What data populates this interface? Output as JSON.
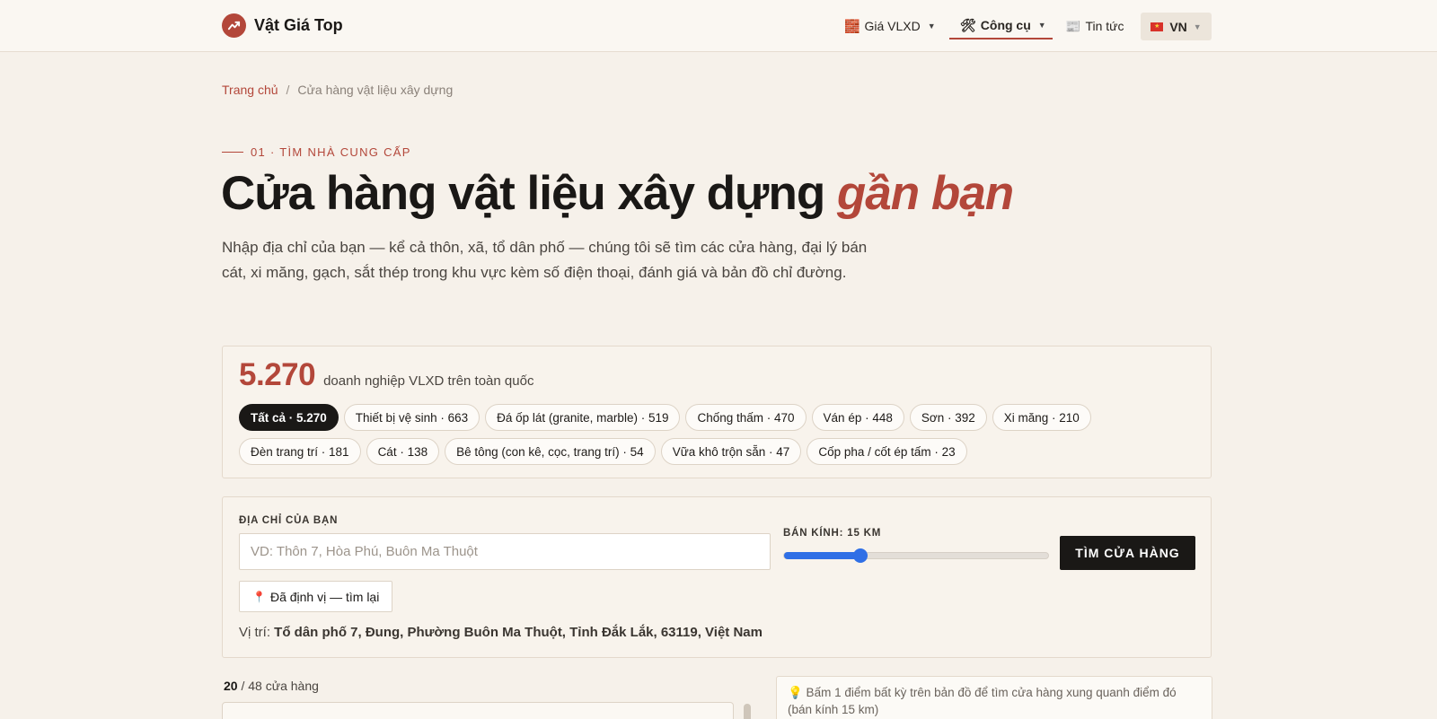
{
  "header": {
    "brand_name": "Vật Giá Top",
    "nav": [
      {
        "icon": "brick-icon",
        "glyph": "🧱",
        "label": "Giá VLXD"
      },
      {
        "icon": "tools-icon",
        "glyph": "🛠",
        "label": "Công cụ"
      },
      {
        "icon": "newspaper-icon",
        "glyph": "📰",
        "label": "Tin tức"
      }
    ],
    "language": "VN"
  },
  "breadcrumb": {
    "home": "Trang chủ",
    "separator": "/",
    "current": "Cửa hàng vật liệu xây dựng"
  },
  "hero": {
    "eyebrow": "01 · TÌM NHÀ CUNG CẤP",
    "title_main": "Cửa hàng vật liệu xây dựng ",
    "title_accent": "gần bạn",
    "description": "Nhập địa chỉ của bạn — kể cả thôn, xã, tổ dân phố — chúng tôi sẽ tìm các cửa hàng, đại lý bán cát, xi măng, gạch, sắt thép trong khu vực kèm số điện thoại, đánh giá và bản đồ chỉ đường."
  },
  "stats": {
    "total": "5.270",
    "label": "doanh nghiệp VLXD trên toàn quốc",
    "chips": [
      "Tất cả · 5.270",
      "Thiết bị vệ sinh · 663",
      "Đá ốp lát (granite, marble) · 519",
      "Chống thấm · 470",
      "Ván ép · 448",
      "Sơn · 392",
      "Xi măng · 210",
      "Đèn trang trí · 181",
      "Cát · 138",
      "Bê tông (con kê, cọc, trang trí) · 54",
      "Vữa khô trộn sẵn · 47",
      "Cốp pha / cốt ép tấm · 23"
    ]
  },
  "search": {
    "address_label": "ĐỊA CHỈ CỦA BẠN",
    "address_placeholder": "VD: Thôn 7, Hòa Phú, Buôn Ma Thuột",
    "radius_label": "BÁN KÍNH: 15 KM",
    "radius_fraction": 0.29,
    "submit_label": "TÌM CỬA HÀNG",
    "locate_label": "Đã định vị — tìm lại",
    "location_prefix": "Vị trí: ",
    "location_value": "Tổ dân phố 7, Đung, Phường Buôn Ma Thuột, Tỉnh Đắk Lắk, 63119, Việt Nam"
  },
  "results": {
    "shown": "20",
    "total_text": " / 48 cửa hàng",
    "map_tip": "💡 Bấm 1 điểm bất kỳ trên bản đồ để tìm cửa hàng xung quanh điểm đó (bán kính 15 km)"
  },
  "colors": {
    "accent": "#b3473a",
    "dark": "#1a1816",
    "background": "#f6f1ea",
    "slider": "#2f6fe6"
  }
}
